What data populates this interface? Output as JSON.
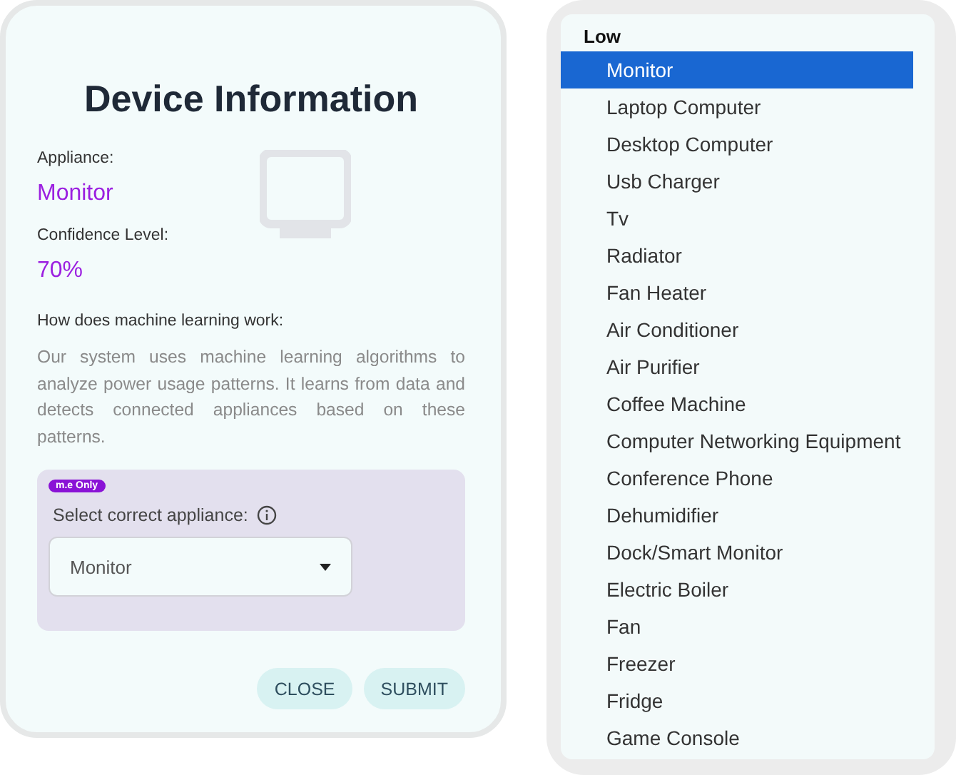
{
  "dialog": {
    "title": "Device Information",
    "appliance_label": "Appliance:",
    "appliance": "Monitor",
    "confidence_label": "Confidence Level:",
    "confidence": "70%",
    "ml_heading": "How does machine learning work:",
    "ml_text": "Our system uses machine learning algorithms to analyze power usage patterns. It learns from data and detects connected appliances based on these patterns.",
    "correction": {
      "badge": "m.e Only",
      "label": "Select correct appliance:",
      "select_value": "Monitor"
    },
    "buttons": [
      "CLOSE",
      "SUBMIT"
    ]
  },
  "dropdown": {
    "group": "Low",
    "options": [
      {
        "label": "Monitor",
        "selected": true
      },
      {
        "label": "Laptop Computer",
        "selected": false
      },
      {
        "label": "Desktop Computer",
        "selected": false
      },
      {
        "label": "Usb Charger",
        "selected": false
      },
      {
        "label": "Tv",
        "selected": false
      },
      {
        "label": "Radiator",
        "selected": false
      },
      {
        "label": "Fan Heater",
        "selected": false
      },
      {
        "label": "Air Conditioner",
        "selected": false
      },
      {
        "label": "Air Purifier",
        "selected": false
      },
      {
        "label": "Coffee Machine",
        "selected": false
      },
      {
        "label": "Computer Networking Equipment",
        "selected": false
      },
      {
        "label": "Conference Phone",
        "selected": false
      },
      {
        "label": "Dehumidifier",
        "selected": false
      },
      {
        "label": "Dock/Smart Monitor",
        "selected": false
      },
      {
        "label": "Electric Boiler",
        "selected": false
      },
      {
        "label": "Fan",
        "selected": false
      },
      {
        "label": "Freezer",
        "selected": false
      },
      {
        "label": "Fridge",
        "selected": false
      },
      {
        "label": "Game Console",
        "selected": false
      }
    ]
  }
}
